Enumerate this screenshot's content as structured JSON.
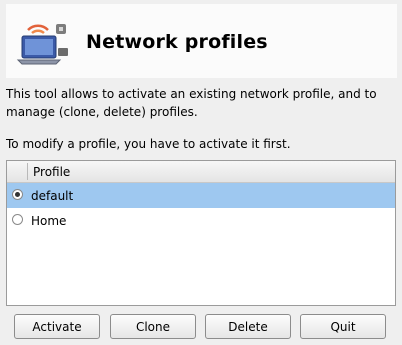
{
  "header": {
    "title": "Network profiles",
    "icon": "network-profile-icon"
  },
  "description": "This tool allows to activate an existing network profile, and to\nmanage (clone, delete) profiles.",
  "note": "To modify a profile, you have to activate it first.",
  "list": {
    "column": "Profile",
    "rows": [
      {
        "label": "default",
        "selected": true
      },
      {
        "label": "Home",
        "selected": false
      }
    ]
  },
  "buttons": {
    "activate": "Activate",
    "clone": "Clone",
    "delete": "Delete",
    "quit": "Quit"
  },
  "colors": {
    "selection": "#9ec8f0",
    "header_bg": "#fbfbfb"
  }
}
